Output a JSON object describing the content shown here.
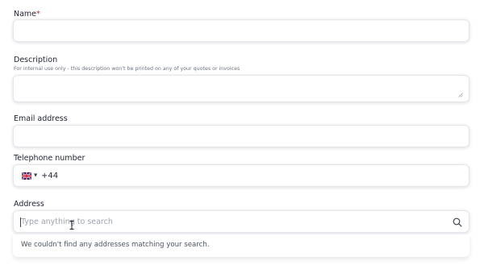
{
  "form": {
    "name": {
      "label": "Name",
      "required_mark": "*",
      "value": ""
    },
    "description": {
      "label": "Description",
      "hint": "For internal use only - this description won't be printed on any of your quotes or invoices",
      "value": ""
    },
    "email": {
      "label": "Email address",
      "value": ""
    },
    "telephone": {
      "label": "Telephone number",
      "country_flag_icon": "uk-flag-icon",
      "dial_code": "+44",
      "value": ""
    },
    "address": {
      "label": "Address",
      "placeholder": "Type anything to search",
      "search_icon": "search-icon",
      "no_results_message": "We couldn't find any addresses matching your search."
    }
  },
  "colors": {
    "required": "#c0262d",
    "border": "#e3e6eb",
    "label_text": "#1f2330",
    "hint_text": "#6b7280",
    "placeholder": "#9ca3af"
  }
}
